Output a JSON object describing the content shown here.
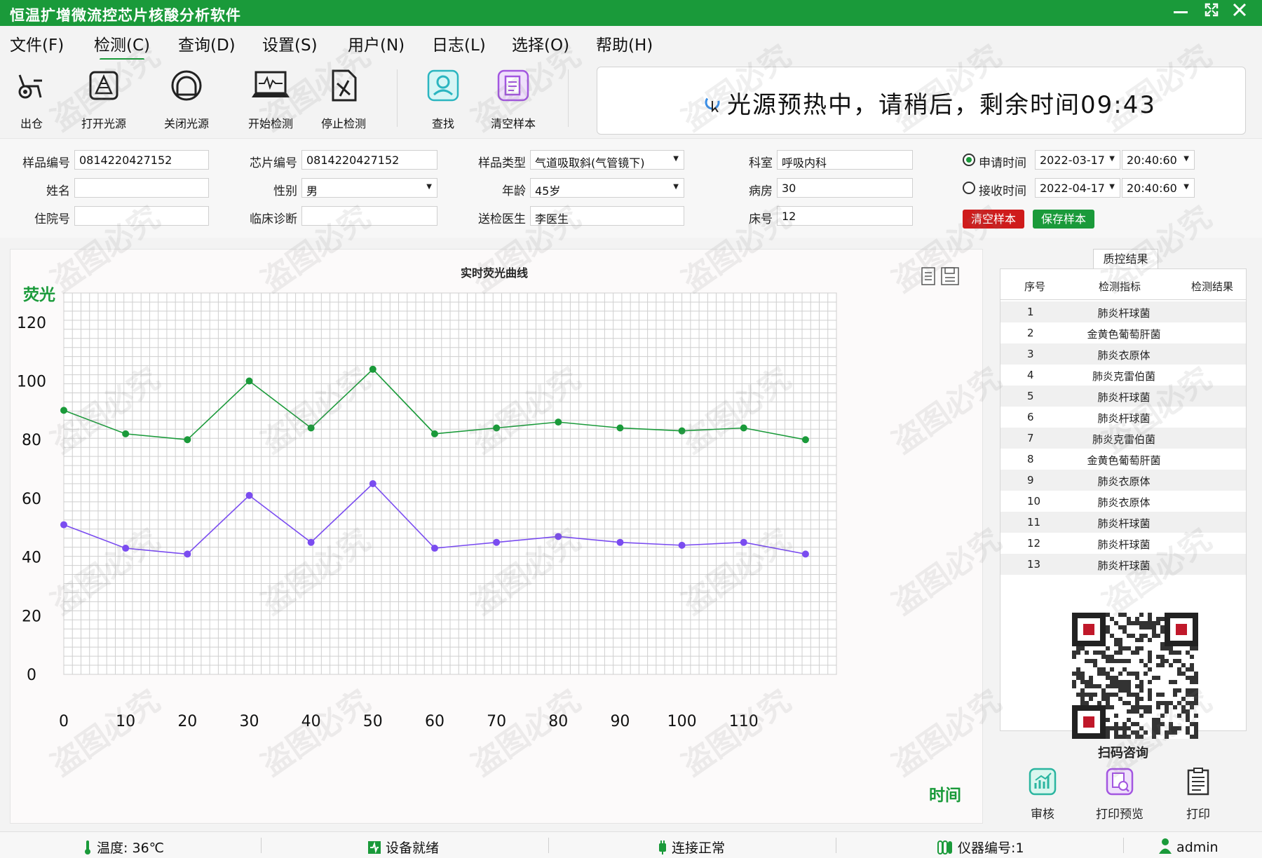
{
  "app": {
    "title": "恒温扩增微流控芯片核酸分析软件"
  },
  "menu": [
    "文件(F)",
    "检测(C)",
    "查询(D)",
    "设置(S)",
    "用户(N)",
    "日志(L)",
    "选择(O)",
    "帮助(H)"
  ],
  "toolbar": {
    "out": "出仓",
    "open_light": "打开光源",
    "close_light": "关闭光源",
    "start": "开始检测",
    "stop": "停止检测",
    "search": "查找",
    "clear": "清空样本"
  },
  "status_message": "光源预热中，请稍后，剩余时间09:43",
  "form": {
    "sample_no_label": "样品编号",
    "sample_no": "0814220427152",
    "chip_no_label": "芯片编号",
    "chip_no": "0814220427152",
    "sample_type_label": "样品类型",
    "sample_type": "气道吸取斜(气管镜下)",
    "dept_label": "科室",
    "dept": "呼吸内科",
    "name_label": "姓名",
    "name": "",
    "gender_label": "性别",
    "gender": "男",
    "age_label": "年龄",
    "age": "45岁",
    "ward_label": "病房",
    "ward": "30",
    "inpatient_label": "住院号",
    "inpatient": "",
    "diagnosis_label": "临床诊断",
    "diagnosis": "",
    "doctor_label": "送检医生",
    "doctor": "李医生",
    "bed_label": "床号",
    "bed": "12",
    "apply_time_label": "申请时间",
    "apply_date": "2022-03-17",
    "apply_clock": "20:40:60",
    "receive_time_label": "接收时间",
    "receive_date": "2022-04-17",
    "receive_clock": "20:40:60",
    "clear_btn": "清空样本",
    "save_btn": "保存样本"
  },
  "chart_data": {
    "type": "line",
    "title": "实时荧光曲线",
    "ylabel": "荧光",
    "xlabel": "时间",
    "ylim": [
      0,
      130
    ],
    "xlim": [
      0,
      125
    ],
    "yticks": [
      0,
      20,
      40,
      60,
      80,
      100,
      120
    ],
    "xticks": [
      0,
      10,
      20,
      30,
      40,
      50,
      60,
      70,
      80,
      90,
      100,
      110
    ],
    "grid": true,
    "x": [
      0,
      10,
      20,
      30,
      40,
      50,
      60,
      70,
      80,
      90,
      100,
      110,
      120
    ],
    "series": [
      {
        "color": "#1a9a3a",
        "values": [
          90,
          82,
          80,
          100,
          84,
          104,
          82,
          84,
          86,
          84,
          83,
          84,
          80
        ]
      },
      {
        "color": "#7a4cf0",
        "values": [
          51,
          43,
          41,
          61,
          45,
          65,
          43,
          45,
          47,
          45,
          44,
          45,
          41
        ]
      }
    ]
  },
  "qc": {
    "tab": "质控结果",
    "headers": [
      "序号",
      "检测指标",
      "检测结果"
    ],
    "rows": [
      [
        "1",
        "肺炎杆球菌",
        ""
      ],
      [
        "2",
        "金黄色葡萄肝菌",
        ""
      ],
      [
        "3",
        "肺炎衣原体",
        ""
      ],
      [
        "4",
        "肺炎克雷伯菌",
        ""
      ],
      [
        "5",
        "肺炎杆球菌",
        ""
      ],
      [
        "6",
        "肺炎杆球菌",
        ""
      ],
      [
        "7",
        "肺炎克雷伯菌",
        ""
      ],
      [
        "8",
        "金黄色葡萄肝菌",
        ""
      ],
      [
        "9",
        "肺炎衣原体",
        ""
      ],
      [
        "10",
        "肺炎衣原体",
        ""
      ],
      [
        "11",
        "肺炎杆球菌",
        ""
      ],
      [
        "12",
        "肺炎杆球菌",
        ""
      ],
      [
        "13",
        "肺炎杆球菌",
        ""
      ]
    ],
    "qr_caption": "扫码咨询"
  },
  "right_tools": {
    "review": "审核",
    "preview": "打印预览",
    "print": "打印"
  },
  "statusbar": {
    "temperature": "温度: 36℃",
    "device": "设备就绪",
    "connection": "连接正常",
    "instrument": "仪器编号:1",
    "user": "admin"
  },
  "watermark": "盗图必究",
  "colors": {
    "brand": "#1a9a3a",
    "danger": "#cf1b1b",
    "series_green": "#1a9a3a",
    "series_purple": "#7a4cf0"
  }
}
